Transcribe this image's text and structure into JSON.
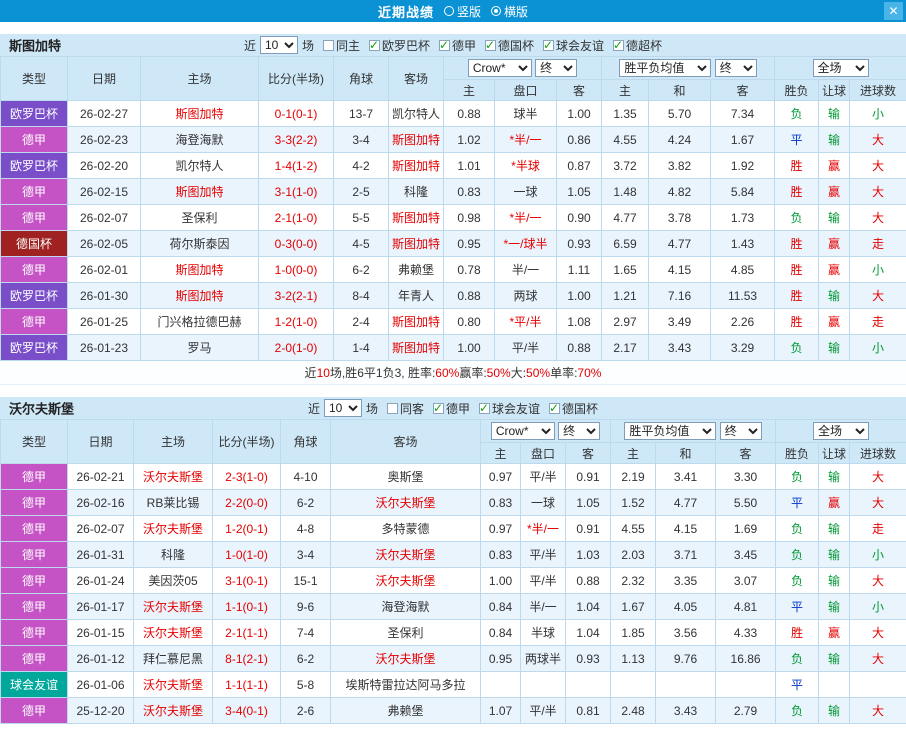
{
  "titlebar": {
    "title": "近期战绩",
    "radios": [
      {
        "label": "竖版",
        "selected": false
      },
      {
        "label": "横版",
        "selected": true
      }
    ],
    "close_label": "✕"
  },
  "table_header": {
    "col_type": "类型",
    "col_date": "日期",
    "col_home": "主场",
    "col_score": "比分(半场)",
    "col_corner": "角球",
    "col_away": "客场",
    "odds_source": "Crow*",
    "odds_final": "终",
    "mean_label": "胜平负均值",
    "mean_final": "终",
    "scope": "全场",
    "sub_home": "主",
    "sub_handicap": "盘口",
    "sub_away": "客",
    "sub_mhome": "主",
    "sub_mdraw": "和",
    "sub_maway": "客",
    "sub_result": "胜负",
    "sub_hresult": "让球",
    "sub_gresult": "进球数"
  },
  "colors": {
    "red": "#e60000",
    "green": "#009933",
    "blue": "#0033cc"
  },
  "type_colors": {
    "欧罗巴杯": "#7a4ec9",
    "德甲": "#c653c6",
    "德国杯": "#9f2121",
    "球会友谊": "#00a79b"
  },
  "sections": [
    {
      "team": "斯图加特",
      "filter": {
        "prefix": "近",
        "count": "10",
        "suffix": "场",
        "checkboxes": [
          {
            "label": "同主",
            "checked": false
          },
          {
            "label": "欧罗巴杯",
            "checked": true
          },
          {
            "label": "德甲",
            "checked": true
          },
          {
            "label": "德国杯",
            "checked": true
          },
          {
            "label": "球会友谊",
            "checked": true
          },
          {
            "label": "德超杯",
            "checked": true
          }
        ]
      },
      "rows": [
        {
          "type": "欧罗巴杯",
          "date": "26-02-27",
          "home": "斯图加特",
          "home_focus": true,
          "score": "0-1(0-1)",
          "corner": "13-7",
          "away": "凯尔特人",
          "away_focus": false,
          "o1": "0.88",
          "hc": "球半",
          "hc_red": false,
          "o2": "1.00",
          "m1": "1.35",
          "m2": "5.70",
          "m3": "7.34",
          "r1": "负",
          "r2": "输",
          "r3": "小"
        },
        {
          "type": "德甲",
          "date": "26-02-23",
          "home": "海登海默",
          "home_focus": false,
          "score": "3-3(2-2)",
          "corner": "3-4",
          "away": "斯图加特",
          "away_focus": true,
          "o1": "1.02",
          "hc": "*半/一",
          "hc_red": true,
          "o2": "0.86",
          "m1": "4.55",
          "m2": "4.24",
          "m3": "1.67",
          "r1": "平",
          "r2": "输",
          "r3": "大"
        },
        {
          "type": "欧罗巴杯",
          "date": "26-02-20",
          "home": "凯尔特人",
          "home_focus": false,
          "score": "1-4(1-2)",
          "corner": "4-2",
          "away": "斯图加特",
          "away_focus": true,
          "o1": "1.01",
          "hc": "*半球",
          "hc_red": true,
          "o2": "0.87",
          "m1": "3.72",
          "m2": "3.82",
          "m3": "1.92",
          "r1": "胜",
          "r2": "赢",
          "r3": "大"
        },
        {
          "type": "德甲",
          "date": "26-02-15",
          "home": "斯图加特",
          "home_focus": true,
          "score": "3-1(1-0)",
          "corner": "2-5",
          "away": "科隆",
          "away_focus": false,
          "o1": "0.83",
          "hc": "一球",
          "hc_red": false,
          "o2": "1.05",
          "m1": "1.48",
          "m2": "4.82",
          "m3": "5.84",
          "r1": "胜",
          "r2": "赢",
          "r3": "大"
        },
        {
          "type": "德甲",
          "date": "26-02-07",
          "home": "圣保利",
          "home_focus": false,
          "score": "2-1(1-0)",
          "corner": "5-5",
          "away": "斯图加特",
          "away_focus": true,
          "o1": "0.98",
          "hc": "*半/一",
          "hc_red": true,
          "o2": "0.90",
          "m1": "4.77",
          "m2": "3.78",
          "m3": "1.73",
          "r1": "负",
          "r2": "输",
          "r3": "大"
        },
        {
          "type": "德国杯",
          "date": "26-02-05",
          "home": "荷尔斯泰因",
          "home_focus": false,
          "score": "0-3(0-0)",
          "corner": "4-5",
          "away": "斯图加特",
          "away_focus": true,
          "o1": "0.95",
          "hc": "*一/球半",
          "hc_red": true,
          "o2": "0.93",
          "m1": "6.59",
          "m2": "4.77",
          "m3": "1.43",
          "r1": "胜",
          "r2": "赢",
          "r3": "走"
        },
        {
          "type": "德甲",
          "date": "26-02-01",
          "home": "斯图加特",
          "home_focus": true,
          "score": "1-0(0-0)",
          "corner": "6-2",
          "away": "弗赖堡",
          "away_focus": false,
          "o1": "0.78",
          "hc": "半/一",
          "hc_red": false,
          "o2": "1.11",
          "m1": "1.65",
          "m2": "4.15",
          "m3": "4.85",
          "r1": "胜",
          "r2": "赢",
          "r3": "小"
        },
        {
          "type": "欧罗巴杯",
          "date": "26-01-30",
          "home": "斯图加特",
          "home_focus": true,
          "score": "3-2(2-1)",
          "corner": "8-4",
          "away": "年青人",
          "away_focus": false,
          "o1": "0.88",
          "hc": "两球",
          "hc_red": false,
          "o2": "1.00",
          "m1": "1.21",
          "m2": "7.16",
          "m3": "11.53",
          "r1": "胜",
          "r2": "输",
          "r3": "大"
        },
        {
          "type": "德甲",
          "date": "26-01-25",
          "home": "门兴格拉德巴赫",
          "home_focus": false,
          "score": "1-2(1-0)",
          "corner": "2-4",
          "away": "斯图加特",
          "away_focus": true,
          "o1": "0.80",
          "hc": "*平/半",
          "hc_red": true,
          "o2": "1.08",
          "m1": "2.97",
          "m2": "3.49",
          "m3": "2.26",
          "r1": "胜",
          "r2": "赢",
          "r3": "走"
        },
        {
          "type": "欧罗巴杯",
          "date": "26-01-23",
          "home": "罗马",
          "home_focus": false,
          "score": "2-0(1-0)",
          "corner": "1-4",
          "away": "斯图加特",
          "away_focus": true,
          "o1": "1.00",
          "hc": "平/半",
          "hc_red": false,
          "o2": "0.88",
          "m1": "2.17",
          "m2": "3.43",
          "m3": "3.29",
          "r1": "负",
          "r2": "输",
          "r3": "小"
        }
      ],
      "summary": [
        {
          "text": "近",
          "color": "#333333"
        },
        {
          "text": "10",
          "color": "#e60000"
        },
        {
          "text": "场,胜6平1负3, 胜率:",
          "color": "#333333"
        },
        {
          "text": "60%",
          "color": "#e60000"
        },
        {
          "text": " 赢率:",
          "color": "#333333"
        },
        {
          "text": "50%",
          "color": "#e60000"
        },
        {
          "text": " 大:",
          "color": "#333333"
        },
        {
          "text": "50%",
          "color": "#e60000"
        },
        {
          "text": " 单率:",
          "color": "#333333"
        },
        {
          "text": "70%",
          "color": "#e60000"
        }
      ]
    },
    {
      "team": "沃尔夫斯堡",
      "filter": {
        "prefix": "近",
        "count": "10",
        "suffix": "场",
        "checkboxes": [
          {
            "label": "同客",
            "checked": false
          },
          {
            "label": "德甲",
            "checked": true
          },
          {
            "label": "球会友谊",
            "checked": true
          },
          {
            "label": "德国杯",
            "checked": true
          }
        ]
      },
      "rows": [
        {
          "type": "德甲",
          "date": "26-02-21",
          "home": "沃尔夫斯堡",
          "home_focus": true,
          "score": "2-3(1-0)",
          "corner": "4-10",
          "away": "奥斯堡",
          "away_focus": false,
          "o1": "0.97",
          "hc": "平/半",
          "hc_red": false,
          "o2": "0.91",
          "m1": "2.19",
          "m2": "3.41",
          "m3": "3.30",
          "r1": "负",
          "r2": "输",
          "r3": "大"
        },
        {
          "type": "德甲",
          "date": "26-02-16",
          "home": "RB莱比锡",
          "home_focus": false,
          "score": "2-2(0-0)",
          "corner": "6-2",
          "away": "沃尔夫斯堡",
          "away_focus": true,
          "o1": "0.83",
          "hc": "一球",
          "hc_red": false,
          "o2": "1.05",
          "m1": "1.52",
          "m2": "4.77",
          "m3": "5.50",
          "r1": "平",
          "r2": "赢",
          "r3": "大"
        },
        {
          "type": "德甲",
          "date": "26-02-07",
          "home": "沃尔夫斯堡",
          "home_focus": true,
          "score": "1-2(0-1)",
          "corner": "4-8",
          "away": "多特蒙德",
          "away_focus": false,
          "o1": "0.97",
          "hc": "*半/一",
          "hc_red": true,
          "o2": "0.91",
          "m1": "4.55",
          "m2": "4.15",
          "m3": "1.69",
          "r1": "负",
          "r2": "输",
          "r3": "走"
        },
        {
          "type": "德甲",
          "date": "26-01-31",
          "home": "科隆",
          "home_focus": false,
          "score": "1-0(1-0)",
          "corner": "3-4",
          "away": "沃尔夫斯堡",
          "away_focus": true,
          "o1": "0.83",
          "hc": "平/半",
          "hc_red": false,
          "o2": "1.03",
          "m1": "2.03",
          "m2": "3.71",
          "m3": "3.45",
          "r1": "负",
          "r2": "输",
          "r3": "小"
        },
        {
          "type": "德甲",
          "date": "26-01-24",
          "home": "美因茨05",
          "home_focus": false,
          "score": "3-1(0-1)",
          "corner": "15-1",
          "away": "沃尔夫斯堡",
          "away_focus": true,
          "o1": "1.00",
          "hc": "平/半",
          "hc_red": false,
          "o2": "0.88",
          "m1": "2.32",
          "m2": "3.35",
          "m3": "3.07",
          "r1": "负",
          "r2": "输",
          "r3": "大"
        },
        {
          "type": "德甲",
          "date": "26-01-17",
          "home": "沃尔夫斯堡",
          "home_focus": true,
          "score": "1-1(0-1)",
          "corner": "9-6",
          "away": "海登海默",
          "away_focus": false,
          "o1": "0.84",
          "hc": "半/一",
          "hc_red": false,
          "o2": "1.04",
          "m1": "1.67",
          "m2": "4.05",
          "m3": "4.81",
          "r1": "平",
          "r2": "输",
          "r3": "小"
        },
        {
          "type": "德甲",
          "date": "26-01-15",
          "home": "沃尔夫斯堡",
          "home_focus": true,
          "score": "2-1(1-1)",
          "corner": "7-4",
          "away": "圣保利",
          "away_focus": false,
          "o1": "0.84",
          "hc": "半球",
          "hc_red": false,
          "o2": "1.04",
          "m1": "1.85",
          "m2": "3.56",
          "m3": "4.33",
          "r1": "胜",
          "r2": "赢",
          "r3": "大"
        },
        {
          "type": "德甲",
          "date": "26-01-12",
          "home": "拜仁慕尼黑",
          "home_focus": false,
          "score": "8-1(2-1)",
          "corner": "6-2",
          "away": "沃尔夫斯堡",
          "away_focus": true,
          "o1": "0.95",
          "hc": "两球半",
          "hc_red": false,
          "o2": "0.93",
          "m1": "1.13",
          "m2": "9.76",
          "m3": "16.86",
          "r1": "负",
          "r2": "输",
          "r3": "大"
        },
        {
          "type": "球会友谊",
          "date": "26-01-06",
          "home": "沃尔夫斯堡",
          "home_focus": true,
          "score": "1-1(1-1)",
          "corner": "5-8",
          "away": "埃斯特雷拉达阿马多拉",
          "away_focus": false,
          "o1": "",
          "hc": "",
          "hc_red": false,
          "o2": "",
          "m1": "",
          "m2": "",
          "m3": "",
          "r1": "平",
          "r2": "",
          "r3": ""
        },
        {
          "type": "德甲",
          "date": "25-12-20",
          "home": "沃尔夫斯堡",
          "home_focus": true,
          "score": "3-4(0-1)",
          "corner": "2-6",
          "away": "弗赖堡",
          "away_focus": false,
          "o1": "1.07",
          "hc": "平/半",
          "hc_red": false,
          "o2": "0.81",
          "m1": "2.48",
          "m2": "3.43",
          "m3": "2.79",
          "r1": "负",
          "r2": "输",
          "r3": "大"
        }
      ]
    }
  ]
}
